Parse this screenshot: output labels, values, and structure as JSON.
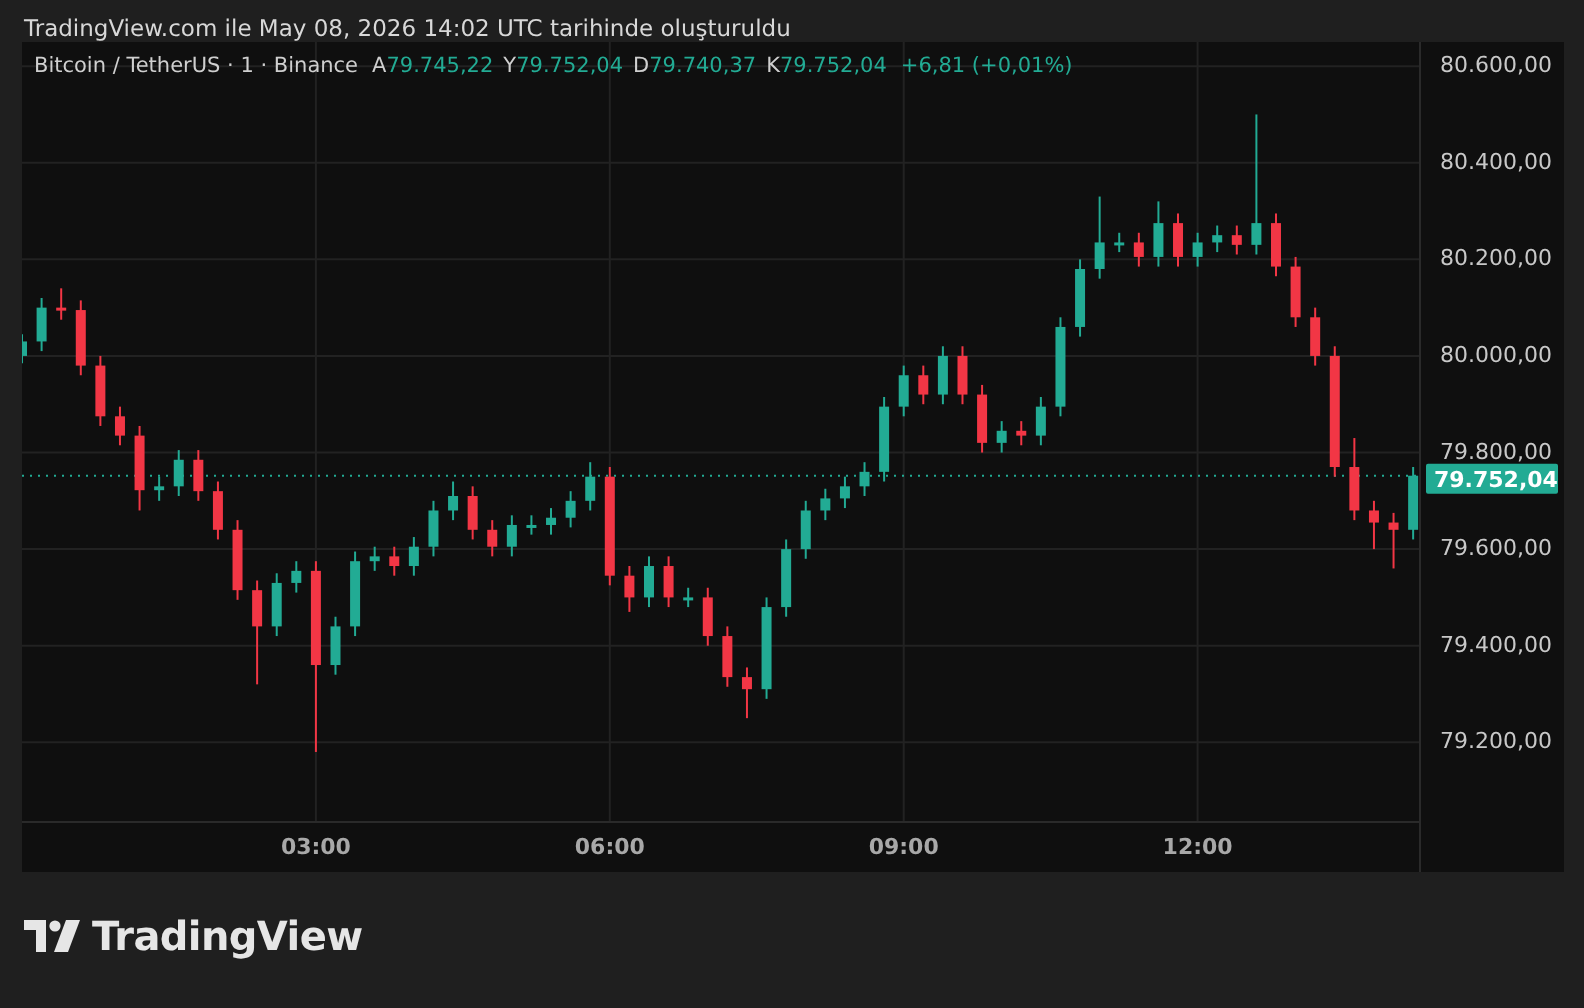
{
  "caption": "TradingView.com ile May 08, 2026 14:02 UTC tarihinde oluşturuldu",
  "legend": {
    "symbol": "Bitcoin / TetherUS · 1 · Binance",
    "fields": [
      {
        "label": "A",
        "value": "79.745,22"
      },
      {
        "label": "Y",
        "value": "79.752,04"
      },
      {
        "label": "D",
        "value": "79.740,37"
      },
      {
        "label": "K",
        "value": "79.752,04"
      }
    ],
    "change": "+6,81 (+0,01%)"
  },
  "chart": {
    "chart_data": {
      "type": "candlestick",
      "grid": true,
      "ref_lines": [
        {
          "axis": "y",
          "value": 79752,
          "color": "#22ab94",
          "line_style": "dotted"
        }
      ],
      "xlim": [
        0,
        14.27
      ],
      "ylim": [
        79035,
        80650
      ],
      "xticks": [
        {
          "value": 3,
          "label": "03:00"
        },
        {
          "value": 6,
          "label": "06:00"
        },
        {
          "value": 9,
          "label": "09:00"
        },
        {
          "value": 12,
          "label": "12:00"
        }
      ],
      "yticks": [
        {
          "value": 79200,
          "label": "79.200,00"
        },
        {
          "value": 79400,
          "label": "79.400,00"
        },
        {
          "value": 79600,
          "label": "79.600,00"
        },
        {
          "value": 79800,
          "label": "79.800,00"
        },
        {
          "value": 80000,
          "label": "80.000,00"
        },
        {
          "value": 80200,
          "label": "80.200,00"
        },
        {
          "value": 80400,
          "label": "80.400,00"
        },
        {
          "value": 80600,
          "label": "80.600,00"
        }
      ],
      "x": [
        0,
        0.2,
        0.4,
        0.6,
        0.8,
        1,
        1.2,
        1.4,
        1.6,
        1.8,
        2,
        2.2,
        2.4,
        2.6,
        2.8,
        3,
        3.2,
        3.4,
        3.6,
        3.8,
        4,
        4.2,
        4.4,
        4.6,
        4.8,
        5,
        5.2,
        5.4,
        5.6,
        5.8,
        6,
        6.2,
        6.4,
        6.6,
        6.8,
        7,
        7.2,
        7.4,
        7.6,
        7.8,
        8,
        8.2,
        8.4,
        8.6,
        8.8,
        9,
        9.2,
        9.4,
        9.6,
        9.8,
        10,
        10.2,
        10.4,
        10.6,
        10.8,
        11,
        11.2,
        11.4,
        11.6,
        11.8,
        12,
        12.2,
        12.4,
        12.6,
        12.8,
        13,
        13.2,
        13.4,
        13.6,
        13.8,
        14,
        14.2
      ],
      "ohlc": [
        [
          80000,
          80045,
          79985,
          80030
        ],
        [
          80030,
          80120,
          80010,
          80100
        ],
        [
          80100,
          80140,
          80075,
          80095
        ],
        [
          80095,
          80115,
          79960,
          79980
        ],
        [
          79980,
          80000,
          79855,
          79875
        ],
        [
          79875,
          79895,
          79815,
          79835
        ],
        [
          79835,
          79855,
          79680,
          79722
        ],
        [
          79722,
          79750,
          79700,
          79730
        ],
        [
          79730,
          79805,
          79710,
          79785
        ],
        [
          79785,
          79805,
          79700,
          79720
        ],
        [
          79720,
          79740,
          79620,
          79640
        ],
        [
          79640,
          79660,
          79495,
          79515
        ],
        [
          79515,
          79535,
          79320,
          79440
        ],
        [
          79440,
          79550,
          79420,
          79530
        ],
        [
          79530,
          79575,
          79510,
          79555
        ],
        [
          79555,
          79575,
          79180,
          79360
        ],
        [
          79360,
          79460,
          79340,
          79440
        ],
        [
          79440,
          79595,
          79420,
          79575
        ],
        [
          79575,
          79605,
          79555,
          79585
        ],
        [
          79585,
          79605,
          79545,
          79565
        ],
        [
          79565,
          79625,
          79545,
          79605
        ],
        [
          79605,
          79700,
          79585,
          79680
        ],
        [
          79680,
          79740,
          79660,
          79710
        ],
        [
          79710,
          79730,
          79620,
          79640
        ],
        [
          79640,
          79660,
          79585,
          79605
        ],
        [
          79605,
          79670,
          79585,
          79650
        ],
        [
          79650,
          79670,
          79630,
          79650
        ],
        [
          79650,
          79685,
          79630,
          79665
        ],
        [
          79665,
          79720,
          79645,
          79700
        ],
        [
          79700,
          79780,
          79680,
          79750
        ],
        [
          79750,
          79770,
          79525,
          79545
        ],
        [
          79545,
          79565,
          79470,
          79500
        ],
        [
          79500,
          79585,
          79480,
          79565
        ],
        [
          79565,
          79585,
          79480,
          79500
        ],
        [
          79500,
          79520,
          79480,
          79500
        ],
        [
          79500,
          79520,
          79400,
          79420
        ],
        [
          79420,
          79440,
          79315,
          79335
        ],
        [
          79335,
          79355,
          79250,
          79310
        ],
        [
          79310,
          79500,
          79290,
          79480
        ],
        [
          79480,
          79620,
          79460,
          79600
        ],
        [
          79600,
          79700,
          79580,
          79680
        ],
        [
          79680,
          79725,
          79660,
          79705
        ],
        [
          79705,
          79750,
          79685,
          79730
        ],
        [
          79730,
          79780,
          79710,
          79760
        ],
        [
          79760,
          79915,
          79740,
          79895
        ],
        [
          79895,
          79980,
          79875,
          79960
        ],
        [
          79960,
          79980,
          79900,
          79920
        ],
        [
          79920,
          80020,
          79900,
          80000
        ],
        [
          80000,
          80020,
          79900,
          79920
        ],
        [
          79920,
          79940,
          79800,
          79820
        ],
        [
          79820,
          79865,
          79800,
          79845
        ],
        [
          79845,
          79865,
          79815,
          79835
        ],
        [
          79835,
          79915,
          79815,
          79895
        ],
        [
          79895,
          80080,
          79875,
          80060
        ],
        [
          80060,
          80200,
          80040,
          80180
        ],
        [
          80180,
          80330,
          80160,
          80235
        ],
        [
          80235,
          80255,
          80215,
          80235
        ],
        [
          80235,
          80255,
          80185,
          80205
        ],
        [
          80205,
          80320,
          80185,
          80275
        ],
        [
          80275,
          80295,
          80185,
          80205
        ],
        [
          80205,
          80255,
          80185,
          80235
        ],
        [
          80235,
          80270,
          80215,
          80250
        ],
        [
          80250,
          80270,
          80210,
          80230
        ],
        [
          80230,
          80500,
          80210,
          80275
        ],
        [
          80275,
          80295,
          80165,
          80185
        ],
        [
          80185,
          80205,
          80060,
          80080
        ],
        [
          80080,
          80100,
          79980,
          80000
        ],
        [
          80000,
          80020,
          79750,
          79770
        ],
        [
          79770,
          79830,
          79660,
          79680
        ],
        [
          79680,
          79700,
          79600,
          79655
        ],
        [
          79655,
          79675,
          79560,
          79640
        ],
        [
          79640,
          79770,
          79620,
          79752
        ]
      ]
    }
  },
  "last_price": {
    "label": "79.752,04"
  },
  "brand": "TradingView"
}
